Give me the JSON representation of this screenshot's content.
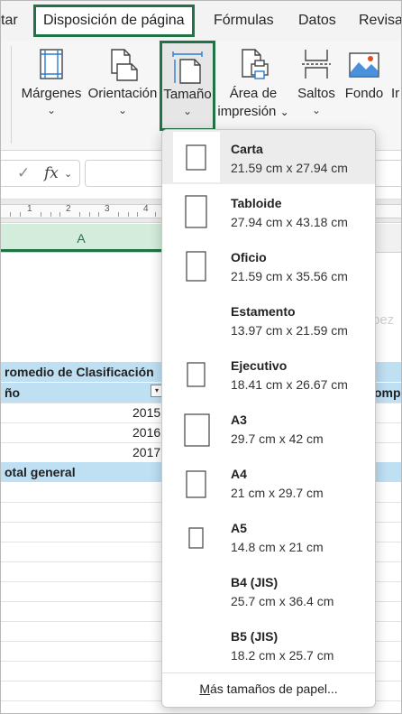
{
  "tabs": [
    {
      "label": "tar",
      "active": false
    },
    {
      "label": "Disposición de página",
      "active": true
    },
    {
      "label": "Fórmulas",
      "active": false
    },
    {
      "label": "Datos",
      "active": false
    },
    {
      "label": "Revisa",
      "active": false
    }
  ],
  "ribbon": {
    "margenes": "Márgenes",
    "orientacion": "Orientación",
    "tamano": "Tamaño",
    "area_line1": "Área de",
    "area_line2": "impresión",
    "saltos": "Saltos",
    "fondo": "Fondo",
    "partial": "Ir"
  },
  "formula_bar": {
    "fx_label": "fx",
    "value": ""
  },
  "ruler": {
    "numbers": [
      "1",
      "2",
      "3",
      "4"
    ]
  },
  "column_header": {
    "label": "A"
  },
  "sheet": {
    "pivot_header": "romedio de Clasificación",
    "row_label_header": "ño",
    "years": [
      "2015",
      "2016",
      "2017"
    ],
    "total_label": "otal general",
    "right_fragment": "omp",
    "ghost_fragment": "pez"
  },
  "dropdown": {
    "options": [
      {
        "name": "Carta",
        "dims": "21.59 cm x 27.94 cm",
        "selected": true
      },
      {
        "name": "Tabloide",
        "dims": "27.94 cm x 43.18 cm",
        "selected": false
      },
      {
        "name": "Oficio",
        "dims": "21.59 cm x 35.56 cm",
        "selected": false
      },
      {
        "name": "Estamento",
        "dims": "13.97 cm x 21.59 cm",
        "selected": false
      },
      {
        "name": "Ejecutivo",
        "dims": "18.41 cm x 26.67 cm",
        "selected": false
      },
      {
        "name": "A3",
        "dims": "29.7 cm x 42 cm",
        "selected": false
      },
      {
        "name": "A4",
        "dims": "21 cm x 29.7 cm",
        "selected": false
      },
      {
        "name": "A5",
        "dims": "14.8 cm x 21 cm",
        "selected": false
      },
      {
        "name": "B4 (JIS)",
        "dims": "25.7 cm x 36.4 cm",
        "selected": false
      },
      {
        "name": "B5 (JIS)",
        "dims": "18.2 cm x 25.7 cm",
        "selected": false
      }
    ],
    "more_link_mnemonic": "M",
    "more_link_rest": "ás tamaños de papel..."
  },
  "colors": {
    "accent_green": "#217346",
    "pivot_blue": "#bfdff3"
  }
}
